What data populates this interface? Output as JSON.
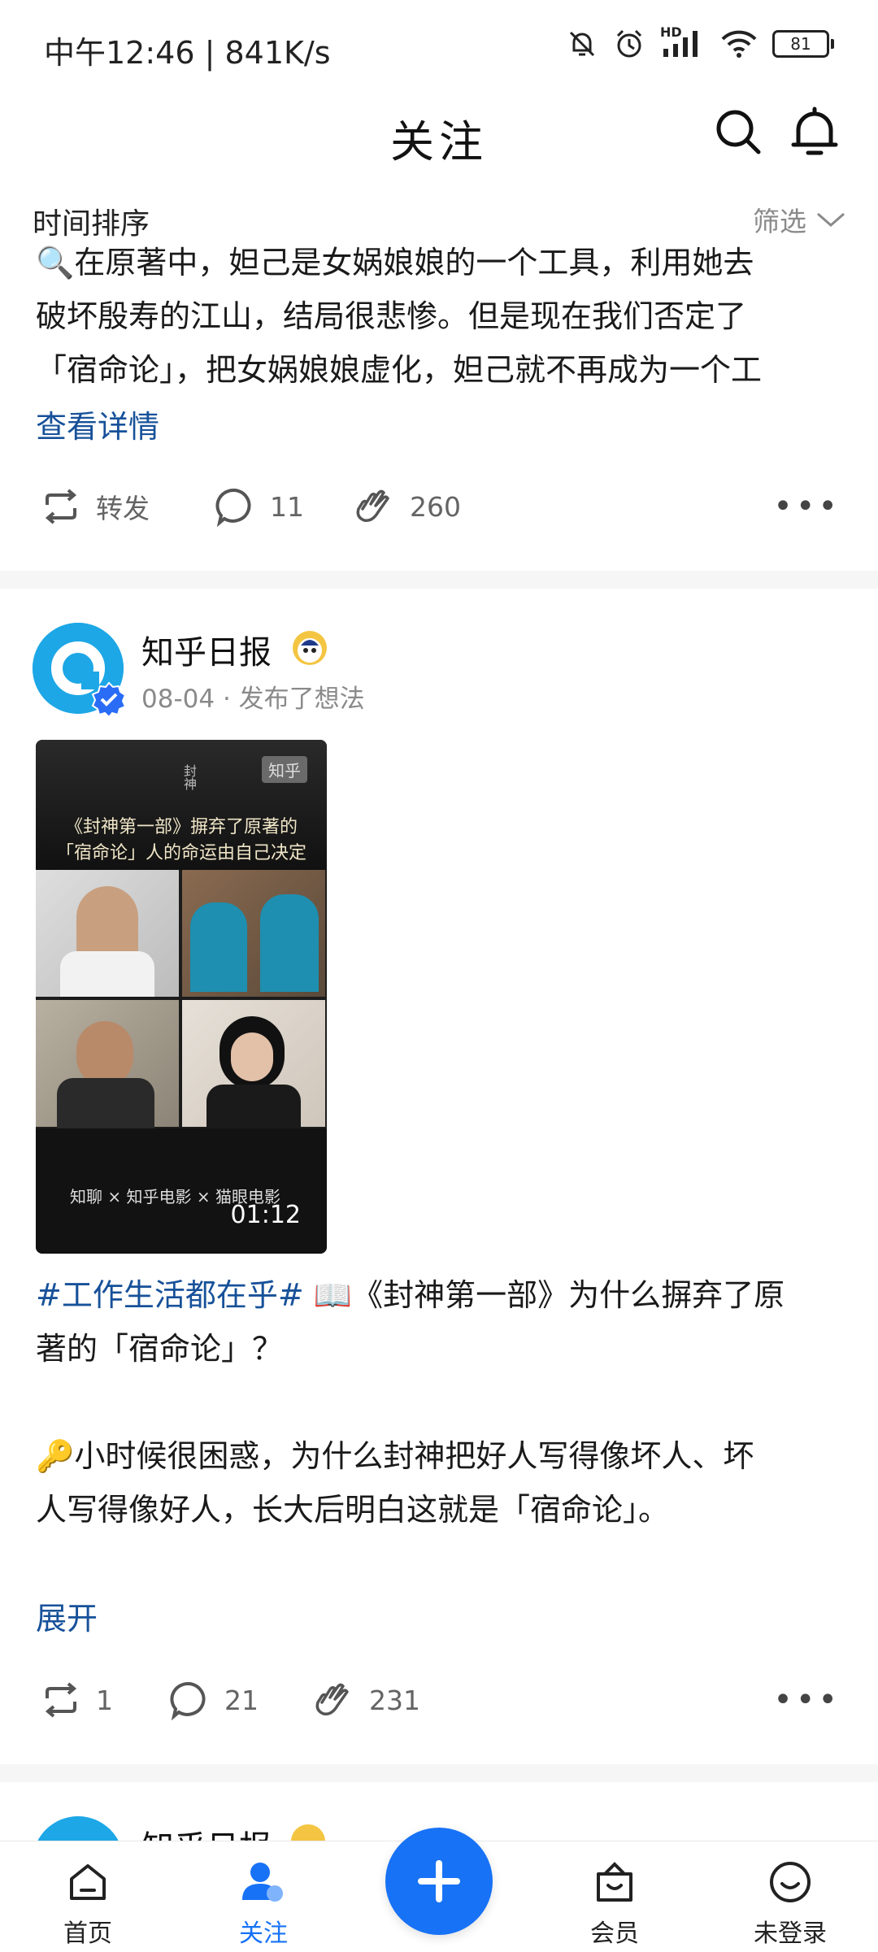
{
  "status_bar": {
    "time": "中午12:46 | 841K/s",
    "battery": "81",
    "network_label": "HD"
  },
  "header": {
    "title": "关注"
  },
  "sort": {
    "label": "时间排序",
    "filter": "筛选"
  },
  "post1": {
    "text_lines": [
      "🔍在原著中，妲己是女娲娘娘的一个工具，利用她去",
      "破坏殷寿的江山，结局很悲惨。但是现在我们否定了",
      "「宿命论」，把女娲娘娘虚化，妲己就不再成为一个工"
    ],
    "detail_link": "查看详情",
    "repost_label": "转发",
    "comments": "11",
    "applause": "260"
  },
  "post2": {
    "author": "知乎日报",
    "date": "08-04",
    "action": "发布了想法",
    "video": {
      "title_line1": "《封神第一部》摒弃了原著的",
      "title_line2": "「宿命论」人的命运由自己决定",
      "watermark": "知乎",
      "duration": "01:12",
      "logos": "知聊 × 知乎电影 × 猫眼电影"
    },
    "topic": "#工作生活都在乎#",
    "line1_rest": " 📖《封神第一部》为什么摒弃了原",
    "line2": "著的「宿命论」？",
    "para2_line1": "🔑小时候很困惑，为什么封神把好人写得像坏人、坏",
    "para2_line2": "人写得像好人，长大后明白这就是「宿命论」。",
    "expand": "展开",
    "reposts": "1",
    "comments": "21",
    "applause": "231"
  },
  "post3": {
    "author": "知乎日报"
  },
  "nav": {
    "home": "首页",
    "follow": "关注",
    "member": "会员",
    "login": "未登录"
  },
  "colors": {
    "accent": "#1772f6",
    "link": "#175199"
  }
}
